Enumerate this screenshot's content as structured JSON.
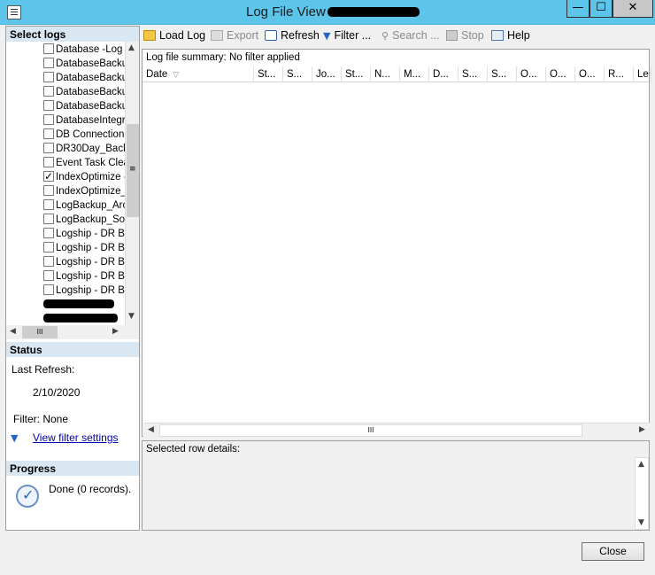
{
  "window": {
    "title": "Log File View",
    "min_glyph": "—",
    "max_glyph": "☐",
    "close_glyph": "✕"
  },
  "left": {
    "select_logs_header": "Select logs",
    "logs": [
      {
        "label": "Database -Log I",
        "checked": false
      },
      {
        "label": "DatabaseBacku",
        "checked": false
      },
      {
        "label": "DatabaseBacku",
        "checked": false
      },
      {
        "label": "DatabaseBacku",
        "checked": false
      },
      {
        "label": "DatabaseBacku",
        "checked": false
      },
      {
        "label": "DatabaseIntegri",
        "checked": false
      },
      {
        "label": "DB Connections",
        "checked": false
      },
      {
        "label": "DR30Day_Back",
        "checked": false
      },
      {
        "label": "Event Task Clea",
        "checked": false
      },
      {
        "label": "IndexOptimize -",
        "checked": true
      },
      {
        "label": "IndexOptimize_I",
        "checked": false
      },
      {
        "label": "LogBackup_Arc",
        "checked": false
      },
      {
        "label": "LogBackup_Sol",
        "checked": false
      },
      {
        "label": "Logship - DR Ba",
        "checked": false
      },
      {
        "label": "Logship - DR Ba",
        "checked": false
      },
      {
        "label": "Logship - DR Ba",
        "checked": false
      },
      {
        "label": "Logship - DR Ba",
        "checked": false
      },
      {
        "label": "Logship - DR Ba",
        "checked": false
      }
    ],
    "status_header": "Status",
    "last_refresh_label": "Last Refresh:",
    "last_refresh_value": "2/10/2020",
    "filter_label": "Filter: None",
    "view_filter_link": "View filter settings",
    "progress_header": "Progress",
    "progress_text": "Done (0 records)."
  },
  "toolbar": {
    "load_log": "Load Log",
    "export": "Export",
    "refresh": "Refresh",
    "filter": "Filter ...",
    "search": "Search ...",
    "stop": "Stop",
    "help": "Help"
  },
  "grid": {
    "summary": "Log file summary: No filter applied",
    "columns": [
      "Date",
      "St...",
      "S...",
      "Jo...",
      "St...",
      "N...",
      "M...",
      "D...",
      "S...",
      "S...",
      "O...",
      "O...",
      "O...",
      "R...",
      "Le"
    ]
  },
  "details": {
    "label": "Selected row details:"
  },
  "footer": {
    "close": "Close"
  }
}
